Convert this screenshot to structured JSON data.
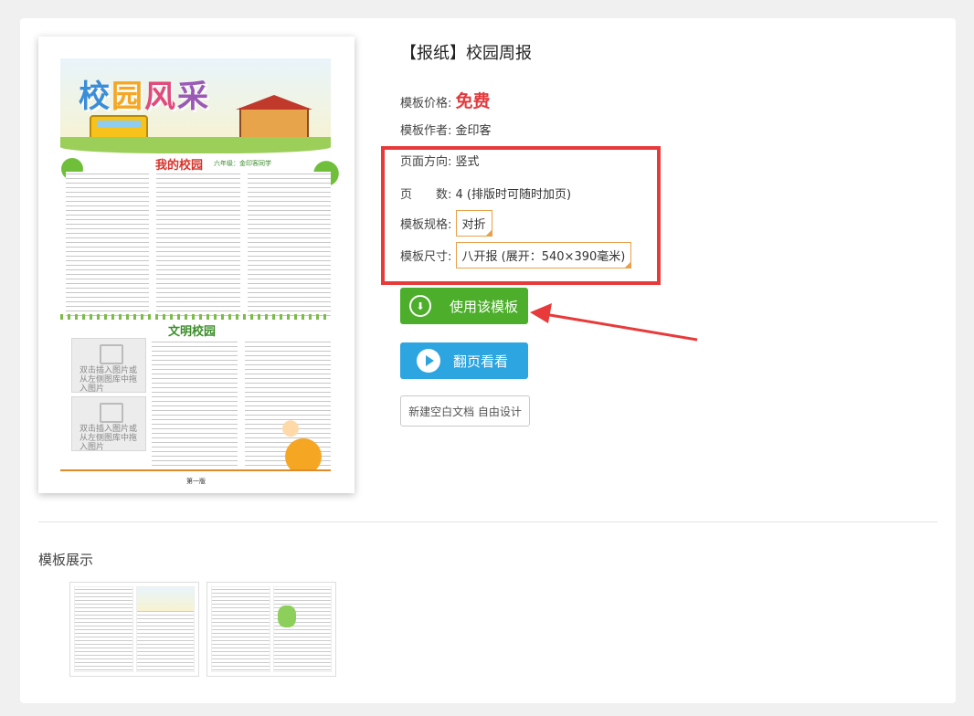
{
  "product": {
    "title": "【报纸】校园周报",
    "price_label": "模板价格:",
    "price_value": "免费",
    "author_label": "模板作者:",
    "author_value": "金印客",
    "orientation_label": "页面方向:",
    "orientation_value": "竖式",
    "pages_label": "页　　数:",
    "pages_value": "4 (排版时可随时加页)",
    "spec_label": "模板规格:",
    "spec_value": "对折",
    "size_label": "模板尺寸:",
    "size_value": "八开报 (展开：540×390毫米)"
  },
  "buttons": {
    "use_template": "使用该模板",
    "flip_view": "翻页看看",
    "new_blank": "新建空白文档 自由设计"
  },
  "preview": {
    "banner_title": [
      "校",
      "园",
      "风",
      "采"
    ],
    "bus_label": "school bus",
    "section1": "我的校园",
    "section1_sub": "六年级：金印客同学",
    "section2": "文明校园",
    "image_placeholder": "双击插入图片或从左侧图库中拖入图片",
    "page_number": "第一版"
  },
  "gallery": {
    "title": "模板展示"
  },
  "colors": {
    "accent_red": "#e83a3a",
    "use_button": "#4cae2a",
    "flip_button": "#2ca5e0",
    "price": "#e4393c"
  },
  "icons": {
    "download": "download-circle-icon",
    "play": "play-circle-icon"
  }
}
